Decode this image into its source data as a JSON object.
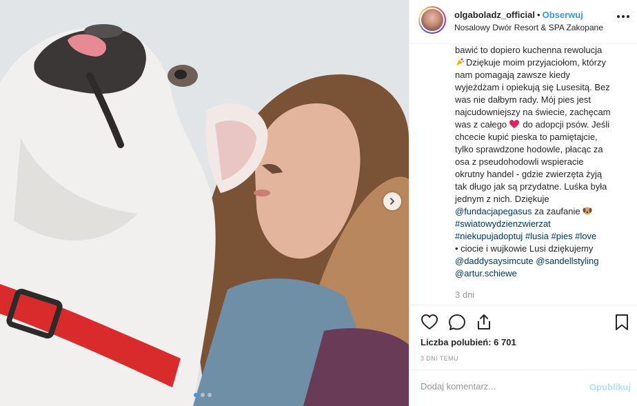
{
  "post": {
    "image_alt": "",
    "carousel_total": 3,
    "carousel_active": 1
  },
  "header": {
    "username": "olgaboladz_official",
    "separator": "•",
    "follow_label": "Obserwuj",
    "location": "Nosalowy Dwór Resort & SPA Zakopane"
  },
  "caption": {
    "lines": {
      "l1": "bawić to dopiero kuchenna rewolucja",
      "l2": "Dziękuje moim przyjaciołom, którzy",
      "l3": "nam pomagają zawsze kiedy",
      "l4": "wyjeżdżam i opiekują się Lusesitą. Bez",
      "l5": "was nie dałbym rady. Mój pies jest",
      "l6": "najcudowniejszy na świecie, zachęcam",
      "l7a": "was z całego",
      "l7b": "do adopcji psów. Jeśli",
      "l8": "chcecie kupić pieska to pamiętajcie,",
      "l9": "tylko sprawdzone hodowle, płacąc za",
      "l10": "osa z pseudohodowli wspieracie",
      "l11": "okrutny handel - gdzie zwierzęta żyją",
      "l12": "tak długo jak są przydatne. Luśka była",
      "l13": "jednym z nich. Dziękuje",
      "l14_mention": "@fundacjapegasus",
      "l14_text": "za zaufanie",
      "l15": "#swiatowydzienzwierzat",
      "l16_tags": "#niekupujadoptuj #lusia #pies #love",
      "l17": "• ciocie i wujkowie Lusi dziękujemy",
      "l18": "@daddysaysimcute @sandellstyling",
      "l19": "@artur.schiewe"
    },
    "time_ago": "3 dni"
  },
  "actions": {
    "likes": "Liczba polubień: 6 701",
    "date": "3 DNI TEMU"
  },
  "comment": {
    "placeholder": "Dodaj komentarz...",
    "publish_label": "Opublikuj"
  },
  "colors": {
    "link": "#00376b",
    "follow": "#3897f0",
    "publish_disabled": "#b2dffc",
    "heart_emoji": "#e0245e",
    "collar": "#d92b2b"
  },
  "icons": [
    "like-heart-icon",
    "comment-icon",
    "share-icon",
    "bookmark-icon",
    "more-options-icon",
    "next-arrow-icon"
  ]
}
